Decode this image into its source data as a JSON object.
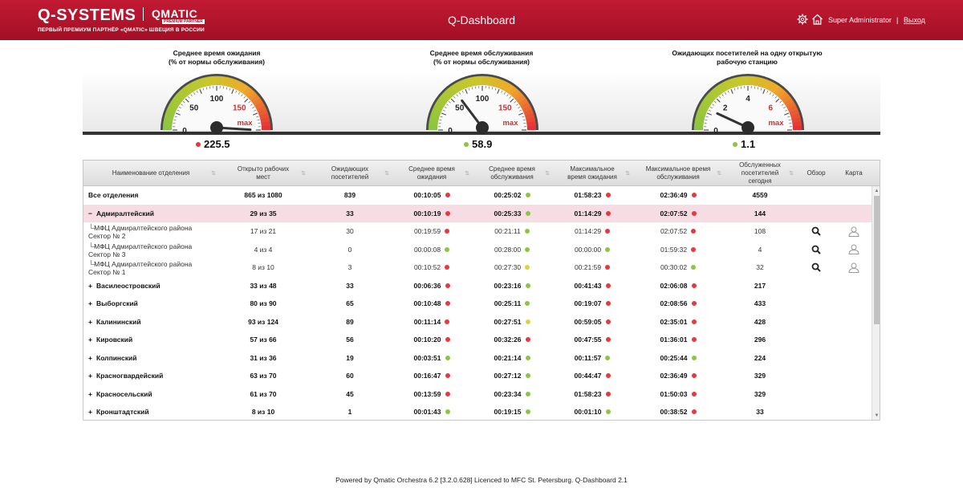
{
  "header": {
    "logo": "Q-SYSTEMS",
    "partner_logo": "QMATIC",
    "partner_logo_sub": "PREMIUM PARTNER",
    "tagline": "ПЕРВЫЙ ПРЕМИУМ ПАРТНЁР «QMATIC» ШВЕЦИЯ В РОССИИ",
    "title": "Q-Dashboard",
    "user": "Super Administrator",
    "divider": "|",
    "logout": "Выход"
  },
  "gauges": [
    {
      "title": "Среднее время ожидания\n(% от нормы обслуживания)",
      "value": "225.5",
      "status": "red",
      "ticks": [
        "0",
        "50",
        "100",
        "150"
      ],
      "max_label": "max",
      "needle": 225.5,
      "scale_max": 200
    },
    {
      "title": "Среднее время обслуживания\n(% от нормы обслуживания)",
      "value": "58.9",
      "status": "green",
      "ticks": [
        "0",
        "50",
        "100",
        "150"
      ],
      "max_label": "max",
      "needle": 58.9,
      "scale_max": 200
    },
    {
      "title": "Ожидающих посетителей на одну открытую\nрабочую станцию",
      "value": "1.1",
      "status": "green",
      "ticks": [
        "0",
        "2",
        "4",
        "6"
      ],
      "max_label": "max",
      "needle": 1.1,
      "scale_max": 8
    }
  ],
  "table": {
    "columns": [
      "Наименование отделения",
      "Открыто рабочих мест",
      "Ожидающих посетителей",
      "Среднее время ожидания",
      "Среднее время обслуживания",
      "Максимальное время ожидания",
      "Максимальное время обслуживания",
      "Обслуженных посетителей сегодня",
      "Обзор",
      "Карта"
    ],
    "rows": [
      {
        "type": "total",
        "name": "Все отделения",
        "open": "865 из 1080",
        "waiting": "839",
        "avg_wait": "00:10:05",
        "avg_wait_s": "red",
        "avg_serv": "00:25:02",
        "avg_serv_s": "green",
        "max_wait": "01:58:23",
        "max_wait_s": "red",
        "max_serv": "02:36:49",
        "max_serv_s": "red",
        "served": "4559"
      },
      {
        "type": "group",
        "expander": "−",
        "name": "Адмиралтейский",
        "open": "29 из 35",
        "waiting": "33",
        "avg_wait": "00:10:19",
        "avg_wait_s": "red",
        "avg_serv": "00:25:33",
        "avg_serv_s": "green",
        "max_wait": "01:14:29",
        "max_wait_s": "red",
        "max_serv": "02:07:52",
        "max_serv_s": "red",
        "served": "144",
        "selected": true
      },
      {
        "type": "sub",
        "name": "МФЦ Адмиралтейского района Сектор № 2",
        "open": "17 из 21",
        "waiting": "30",
        "avg_wait": "00:19:59",
        "avg_wait_s": "red",
        "avg_serv": "00:21:11",
        "avg_serv_s": "green",
        "max_wait": "01:14:29",
        "max_wait_s": "red",
        "max_serv": "02:07:52",
        "max_serv_s": "red",
        "served": "108"
      },
      {
        "type": "sub",
        "name": "МФЦ Адмиралтейского района Сектор № 3",
        "open": "4 из 4",
        "waiting": "0",
        "avg_wait": "00:00:08",
        "avg_wait_s": "green",
        "avg_serv": "00:28:00",
        "avg_serv_s": "green",
        "max_wait": "00:00:00",
        "max_wait_s": "green",
        "max_serv": "01:59:32",
        "max_serv_s": "red",
        "served": "4"
      },
      {
        "type": "sub",
        "name": "МФЦ Адмиралтейского района Сектор № 1",
        "open": "8 из 10",
        "waiting": "3",
        "avg_wait": "00:10:52",
        "avg_wait_s": "red",
        "avg_serv": "00:27:30",
        "avg_serv_s": "yellow",
        "max_wait": "00:21:59",
        "max_wait_s": "red",
        "max_serv": "00:30:02",
        "max_serv_s": "green",
        "served": "32"
      },
      {
        "type": "group",
        "expander": "+",
        "name": "Василеостровский",
        "open": "33 из 48",
        "waiting": "33",
        "avg_wait": "00:06:36",
        "avg_wait_s": "red",
        "avg_serv": "00:23:16",
        "avg_serv_s": "green",
        "max_wait": "00:41:43",
        "max_wait_s": "red",
        "max_serv": "02:06:08",
        "max_serv_s": "red",
        "served": "217"
      },
      {
        "type": "group",
        "expander": "+",
        "name": "Выборгский",
        "open": "80 из 90",
        "waiting": "65",
        "avg_wait": "00:10:48",
        "avg_wait_s": "red",
        "avg_serv": "00:25:11",
        "avg_serv_s": "green",
        "max_wait": "00:19:07",
        "max_wait_s": "red",
        "max_serv": "02:08:56",
        "max_serv_s": "red",
        "served": "433"
      },
      {
        "type": "group",
        "expander": "+",
        "name": "Калининский",
        "open": "93 из 124",
        "waiting": "89",
        "avg_wait": "00:11:14",
        "avg_wait_s": "red",
        "avg_serv": "00:27:51",
        "avg_serv_s": "yellow",
        "max_wait": "00:59:05",
        "max_wait_s": "red",
        "max_serv": "02:35:01",
        "max_serv_s": "red",
        "served": "428"
      },
      {
        "type": "group",
        "expander": "+",
        "name": "Кировский",
        "open": "57 из 66",
        "waiting": "56",
        "avg_wait": "00:10:20",
        "avg_wait_s": "red",
        "avg_serv": "00:32:26",
        "avg_serv_s": "red",
        "max_wait": "00:47:55",
        "max_wait_s": "red",
        "max_serv": "01:36:01",
        "max_serv_s": "red",
        "served": "296"
      },
      {
        "type": "group",
        "expander": "+",
        "name": "Колпинский",
        "open": "31 из 36",
        "waiting": "19",
        "avg_wait": "00:03:51",
        "avg_wait_s": "green",
        "avg_serv": "00:21:14",
        "avg_serv_s": "green",
        "max_wait": "00:11:57",
        "max_wait_s": "green",
        "max_serv": "00:25:44",
        "max_serv_s": "green",
        "served": "224"
      },
      {
        "type": "group",
        "expander": "+",
        "name": "Красногвардейский",
        "open": "63 из 70",
        "waiting": "60",
        "avg_wait": "00:16:47",
        "avg_wait_s": "red",
        "avg_serv": "00:27:12",
        "avg_serv_s": "green",
        "max_wait": "00:44:47",
        "max_wait_s": "red",
        "max_serv": "02:36:49",
        "max_serv_s": "red",
        "served": "329"
      },
      {
        "type": "group",
        "expander": "+",
        "name": "Красносельский",
        "open": "61 из 70",
        "waiting": "45",
        "avg_wait": "00:13:59",
        "avg_wait_s": "red",
        "avg_serv": "00:23:34",
        "avg_serv_s": "green",
        "max_wait": "01:58:23",
        "max_wait_s": "red",
        "max_serv": "01:50:03",
        "max_serv_s": "red",
        "served": "329"
      },
      {
        "type": "group",
        "expander": "+",
        "name": "Кронштадтский",
        "open": "8 из 10",
        "waiting": "1",
        "avg_wait": "00:01:43",
        "avg_wait_s": "green",
        "avg_serv": "00:19:15",
        "avg_serv_s": "green",
        "max_wait": "00:01:10",
        "max_wait_s": "green",
        "max_serv": "00:38:52",
        "max_serv_s": "red",
        "served": "33"
      }
    ]
  },
  "colors": {
    "header": "#b0142c",
    "red": "#e8383d",
    "green": "#8cc63f",
    "yellow": "#e0d23a",
    "selected_row": "#f5dde3"
  },
  "footer": "Powered by Qmatic Orchestra 6.2 [3.2.0.628] Licenced to MFC St. Petersburg. Q-Dashboard 2.1"
}
